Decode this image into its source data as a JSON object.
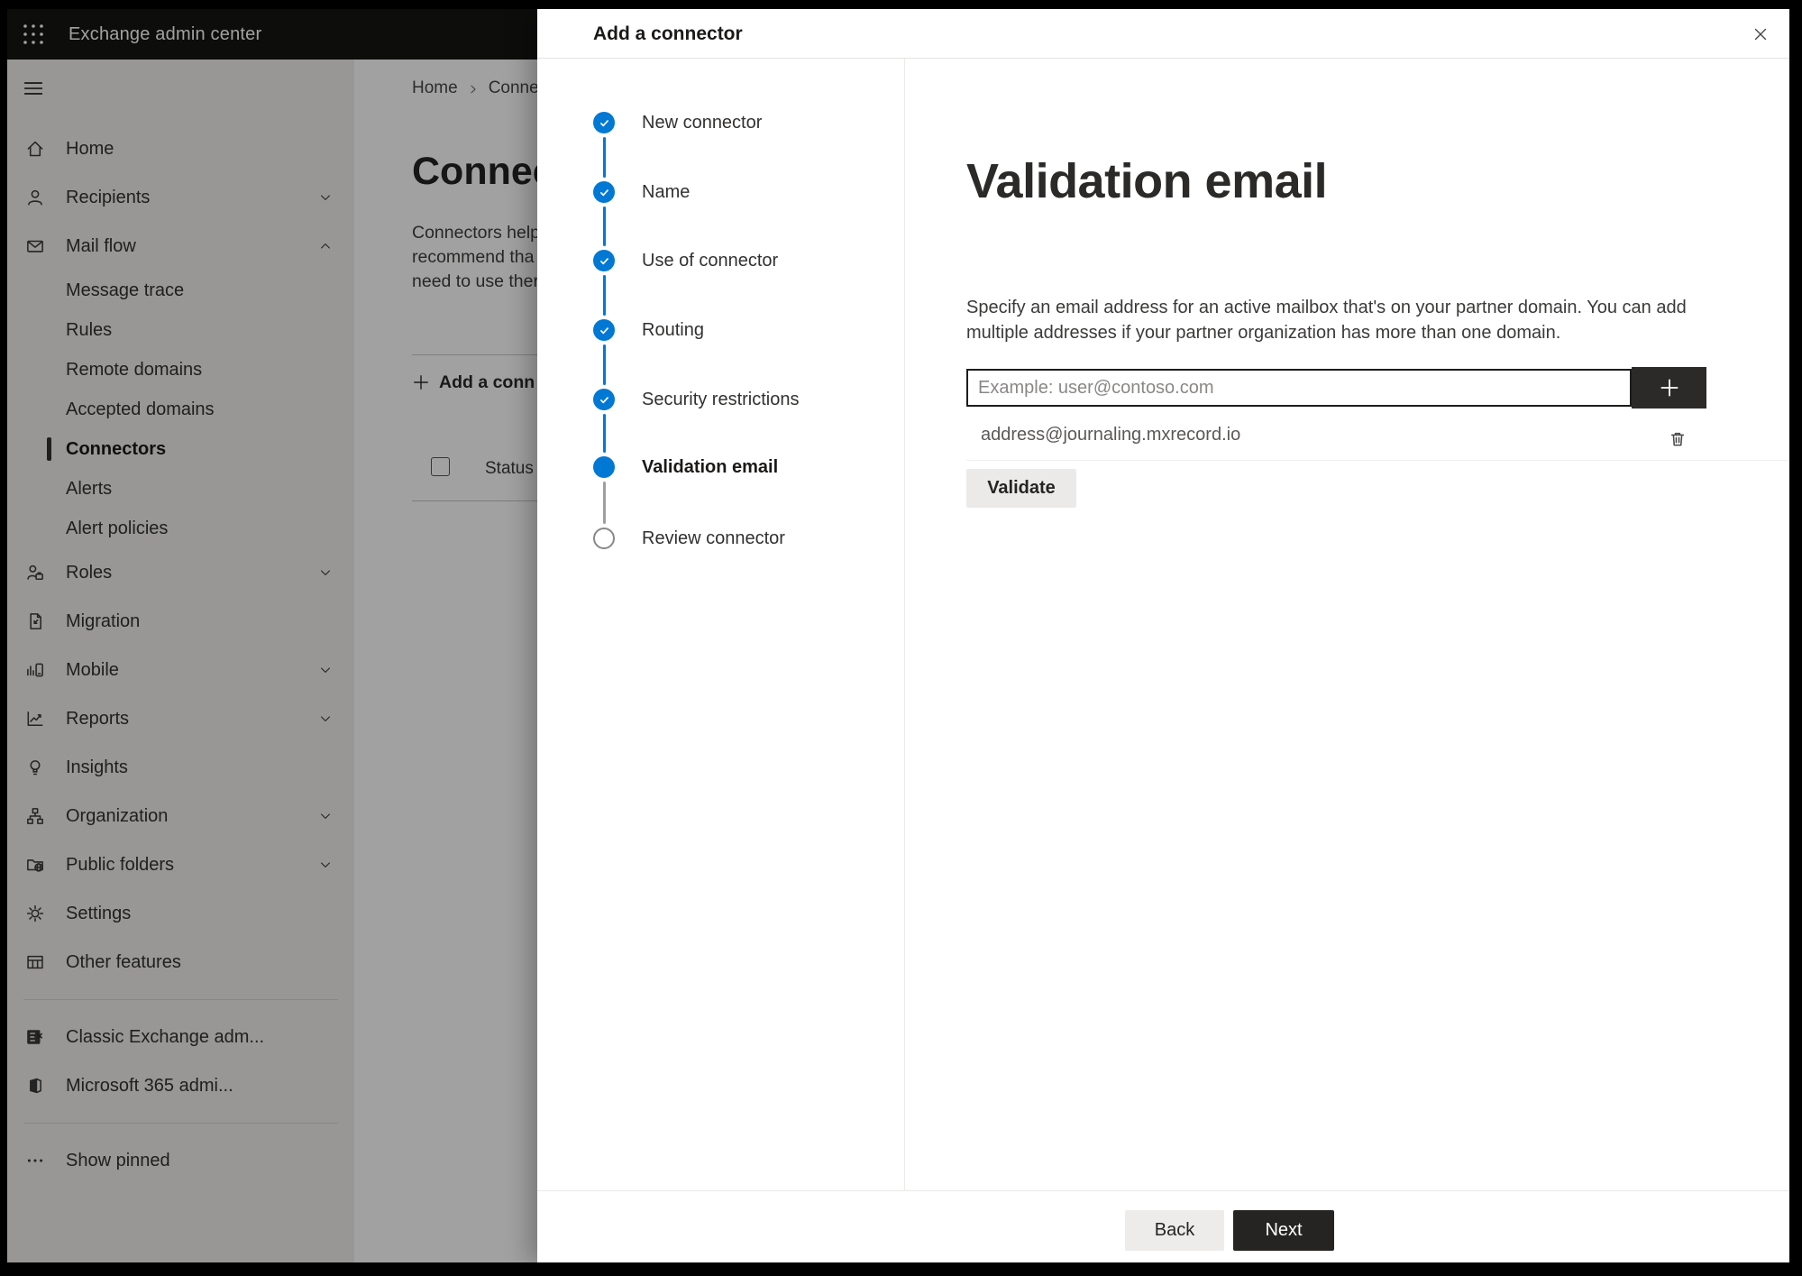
{
  "app_header": {
    "title": "Exchange admin center"
  },
  "sidebar": {
    "items": [
      {
        "label": "Home",
        "icon": "home",
        "type": "top"
      },
      {
        "label": "Recipients",
        "icon": "person",
        "type": "top",
        "chevron": "down"
      },
      {
        "label": "Mail flow",
        "icon": "mail",
        "type": "top",
        "chevron": "up"
      },
      {
        "label": "Message trace",
        "type": "sub"
      },
      {
        "label": "Rules",
        "type": "sub"
      },
      {
        "label": "Remote domains",
        "type": "sub"
      },
      {
        "label": "Accepted domains",
        "type": "sub"
      },
      {
        "label": "Connectors",
        "type": "sub",
        "selected": true
      },
      {
        "label": "Alerts",
        "type": "sub"
      },
      {
        "label": "Alert policies",
        "type": "sub"
      },
      {
        "label": "Roles",
        "icon": "roles",
        "type": "top",
        "chevron": "down"
      },
      {
        "label": "Migration",
        "icon": "migration",
        "type": "top"
      },
      {
        "label": "Mobile",
        "icon": "mobile",
        "type": "top",
        "chevron": "down"
      },
      {
        "label": "Reports",
        "icon": "reports",
        "type": "top",
        "chevron": "down"
      },
      {
        "label": "Insights",
        "icon": "insights",
        "type": "top"
      },
      {
        "label": "Organization",
        "icon": "organization",
        "type": "top",
        "chevron": "down"
      },
      {
        "label": "Public folders",
        "icon": "public-folders",
        "type": "top",
        "chevron": "down"
      },
      {
        "label": "Settings",
        "icon": "settings",
        "type": "top"
      },
      {
        "label": "Other features",
        "icon": "other-features",
        "type": "top"
      },
      {
        "divider": true
      },
      {
        "label": "Classic Exchange adm...",
        "icon": "classic-exchange",
        "type": "top"
      },
      {
        "label": "Microsoft 365 admi...",
        "icon": "microsoft-365",
        "type": "top"
      },
      {
        "divider": true
      },
      {
        "label": "Show pinned",
        "icon": "ellipsis",
        "type": "top"
      }
    ]
  },
  "page": {
    "breadcrumb": {
      "home": "Home",
      "current": "Conne"
    },
    "title": "Connec",
    "intro_lines": [
      "Connectors help",
      "recommend tha",
      "need to use ther"
    ],
    "add_button": "Add a conn",
    "status_header": "Status"
  },
  "wizard": {
    "title": "Add a connector",
    "steps": [
      {
        "label": "New connector",
        "state": "done"
      },
      {
        "label": "Name",
        "state": "done"
      },
      {
        "label": "Use of connector",
        "state": "done"
      },
      {
        "label": "Routing",
        "state": "done"
      },
      {
        "label": "Security restrictions",
        "state": "done"
      },
      {
        "label": "Validation email",
        "state": "current"
      },
      {
        "label": "Review connector",
        "state": "todo"
      }
    ],
    "heading": "Validation email",
    "description_lines": [
      "Specify an email address for an active mailbox that's on your partner domain. You can add",
      "multiple addresses if your partner organization has more than one domain."
    ],
    "email_input_placeholder": "Example: user@contoso.com",
    "added_email": "address@journaling.mxrecord.io",
    "validate_button": "Validate",
    "back_button": "Back",
    "next_button": "Next"
  },
  "colors": {
    "accent_blue": "#0078d4",
    "dark_button": "#252423",
    "header_bg": "#161514",
    "sidebar_bg": "#f1efed"
  }
}
